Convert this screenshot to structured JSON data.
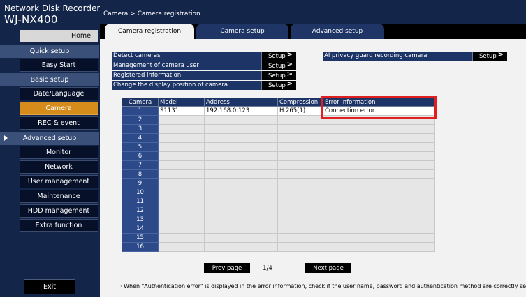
{
  "brand": {
    "line1": "Network Disk Recorder",
    "line2": "WJ-NX400"
  },
  "sidebar": {
    "home": "Home",
    "quick_setup": "Quick setup",
    "easy_start": "Easy Start",
    "basic_setup": "Basic setup",
    "date_language": "Date/Language",
    "camera": "Camera",
    "rec_event": "REC & event",
    "advanced_setup": "Advanced setup",
    "monitor": "Monitor",
    "network": "Network",
    "user_management": "User management",
    "maintenance": "Maintenance",
    "hdd_management": "HDD management",
    "extra_function": "Extra function",
    "exit": "Exit"
  },
  "breadcrumb": "Camera > Camera registration",
  "tabs": [
    "Camera registration",
    "Camera setup",
    "Advanced setup"
  ],
  "active_tab": "Camera registration",
  "setup_rows": [
    {
      "label": "Detect cameras",
      "button": "Setup"
    },
    {
      "label": "Management of camera user",
      "button": "Setup"
    },
    {
      "label": "Registered information",
      "button": "Setup"
    },
    {
      "label": "Change the display position of camera",
      "button": "Setup"
    }
  ],
  "ai_row": {
    "label": "AI privacy guard recording camera",
    "button": "Setup"
  },
  "table": {
    "headers": [
      "Camera",
      "Model",
      "Address",
      "Compression",
      "Error information"
    ],
    "rows": [
      {
        "camera": "1",
        "model": "S1131",
        "address": "192.168.0.123",
        "compression": "H.265(1)",
        "error": "Connection error"
      },
      {
        "camera": "2"
      },
      {
        "camera": "3"
      },
      {
        "camera": "4"
      },
      {
        "camera": "5"
      },
      {
        "camera": "6"
      },
      {
        "camera": "7"
      },
      {
        "camera": "8"
      },
      {
        "camera": "9"
      },
      {
        "camera": "10"
      },
      {
        "camera": "11"
      },
      {
        "camera": "12"
      },
      {
        "camera": "13"
      },
      {
        "camera": "14"
      },
      {
        "camera": "15"
      },
      {
        "camera": "16"
      }
    ]
  },
  "pager": {
    "prev": "Prev page",
    "page": "1/4",
    "next": "Next page"
  },
  "note": "· When \"Authentication error\" is displayed in the error information, check if the user name, password and authentication method are correctly set",
  "colors": {
    "sidebar_bg": "#14254a",
    "accent_active": "#d68c1a",
    "header_bar": "#1d3466",
    "highlight": "#e02020"
  }
}
